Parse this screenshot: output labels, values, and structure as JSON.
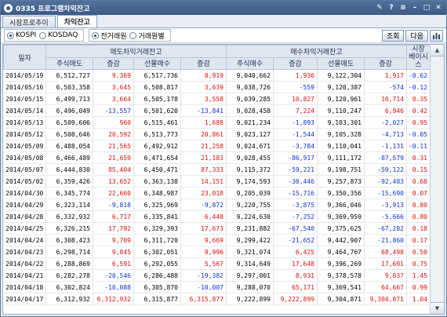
{
  "window": {
    "title": "0335 프로그램차익잔고"
  },
  "tabs": [
    "시장프로추이",
    "차익잔고"
  ],
  "market_options": [
    "KOSPI",
    "KOSDAQ"
  ],
  "period_options": [
    "전거래원",
    "거래원별"
  ],
  "buttons": {
    "query": "조회",
    "next": "다음"
  },
  "table": {
    "col_date": "일자",
    "group_sell": "매도차익거래잔고",
    "group_buy": "매수차익거래잔고",
    "col_basis": "시장\n베이시스",
    "sub_headers": [
      "주식매도",
      "증감",
      "선물매수",
      "증감",
      "주식매수",
      "증감",
      "선물매도",
      "증감"
    ],
    "rows": [
      [
        "2014/05/19",
        "6,512,727",
        "9,369",
        "6,517,736",
        "8,919",
        "9,040,662",
        "1,936",
        "9,122,304",
        "1,917",
        "-0.62"
      ],
      [
        "2014/05/16",
        "6,503,358",
        "3,645",
        "6,508,817",
        "3,639",
        "9,038,726",
        "-559",
        "9,120,387",
        "-574",
        "-0.12"
      ],
      [
        "2014/05/15",
        "6,499,713",
        "3,664",
        "6,505,178",
        "3,558",
        "9,039,285",
        "10,827",
        "9,120,961",
        "10,714",
        "0.35"
      ],
      [
        "2014/05/14",
        "6,496,049",
        "-13,557",
        "6,501,620",
        "-13,841",
        "9,028,458",
        "7,224",
        "9,110,247",
        "6,946",
        "0.42"
      ],
      [
        "2014/05/13",
        "6,509,606",
        "960",
        "6,515,461",
        "1,688",
        "9,021,234",
        "-1,893",
        "9,103,301",
        "-2,027",
        "0.95"
      ],
      [
        "2014/05/12",
        "6,508,646",
        "20,592",
        "6,513,773",
        "20,861",
        "9,023,127",
        "-1,544",
        "9,105,328",
        "-4,713",
        "-0.05"
      ],
      [
        "2014/05/09",
        "6,488,054",
        "21,565",
        "6,492,912",
        "21,258",
        "9,024,671",
        "-3,784",
        "9,110,041",
        "-1,131",
        "-0.11"
      ],
      [
        "2014/05/08",
        "6,466,489",
        "21,659",
        "6,471,654",
        "21,183",
        "9,028,455",
        "-86,917",
        "9,111,172",
        "-87,579",
        "0.31"
      ],
      [
        "2014/05/07",
        "6,444,830",
        "85,404",
        "6,450,471",
        "87,333",
        "9,115,372",
        "-59,221",
        "9,198,751",
        "-59,122",
        "0.15"
      ],
      [
        "2014/05/02",
        "6,359,426",
        "13,652",
        "6,363,138",
        "14,151",
        "9,174,593",
        "-30,446",
        "9,257,873",
        "-92,483",
        "0.68"
      ],
      [
        "2014/04/30",
        "6,345,774",
        "22,660",
        "6,348,987",
        "23,018",
        "9,205,039",
        "-15,716",
        "9,350,356",
        "-15,690",
        "0.07"
      ],
      [
        "2014/04/29",
        "6,323,114",
        "-9,818",
        "6,325,969",
        "-9,872",
        "9,220,755",
        "-3,875",
        "9,366,046",
        "-3,913",
        "0.80"
      ],
      [
        "2014/04/28",
        "6,332,932",
        "6,717",
        "6,335,841",
        "6,448",
        "9,224,630",
        "-7,252",
        "9,369,959",
        "-5,666",
        "0.80"
      ],
      [
        "2014/04/25",
        "6,326,215",
        "17,792",
        "6,329,393",
        "17,673",
        "9,231,882",
        "-67,540",
        "9,375,625",
        "-67,282",
        "0.18"
      ],
      [
        "2014/04/24",
        "6,308,423",
        "9,709",
        "6,311,720",
        "9,669",
        "9,299,422",
        "-21,652",
        "9,442,907",
        "-21,860",
        "0.17"
      ],
      [
        "2014/04/23",
        "6,298,714",
        "9,845",
        "6,302,051",
        "9,996",
        "9,321,074",
        "6,425",
        "9,464,767",
        "68,498",
        "0.50"
      ],
      [
        "2014/04/22",
        "6,288,869",
        "6,591",
        "6,292,055",
        "5,567",
        "9,314,649",
        "17,648",
        "9,396,269",
        "17,691",
        "0.75"
      ],
      [
        "2014/04/21",
        "6,282,278",
        "-20,546",
        "6,286,488",
        "-19,382",
        "9,297,001",
        "8,931",
        "9,378,578",
        "9,037",
        "1.45"
      ],
      [
        "2014/04/18",
        "6,302,824",
        "-10,088",
        "6,305,870",
        "-10,007",
        "9,288,070",
        "65,171",
        "9,369,541",
        "64,667",
        "0.99"
      ],
      [
        "2014/04/17",
        "6,312,932",
        "6,312,932",
        "6,315,877",
        "6,315,877",
        "9,222,899",
        "9,222,899",
        "9,304,871",
        "9,304,871",
        "1.04"
      ]
    ]
  },
  "colors": {
    "up": "#e01010",
    "down": "#1030d8",
    "title_bar": "#3b5a85"
  }
}
